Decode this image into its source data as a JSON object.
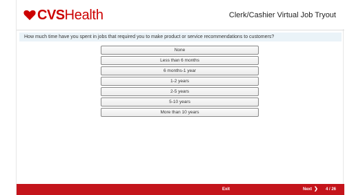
{
  "header": {
    "logo_brand": "CVS",
    "logo_suffix": "Health",
    "title": "Clerk/Cashier Virtual Job Tryout"
  },
  "question": {
    "text": "How much time have you spent in jobs that required you to make product or service recommendations to customers?"
  },
  "options": [
    {
      "label": "None"
    },
    {
      "label": "Less than 6 months"
    },
    {
      "label": "6 months-1 year"
    },
    {
      "label": "1-2 years"
    },
    {
      "label": "2-5 years"
    },
    {
      "label": "5-10 years"
    },
    {
      "label": "More than 10 years"
    }
  ],
  "footer": {
    "exit_label": "Exit",
    "next_label": "Next",
    "next_icon": "chevron-right-icon",
    "page_counter": "4 / 26"
  },
  "colors": {
    "brand_red": "#cc0000",
    "footer_red": "#c4141b",
    "question_bg": "#eaf3f8"
  }
}
